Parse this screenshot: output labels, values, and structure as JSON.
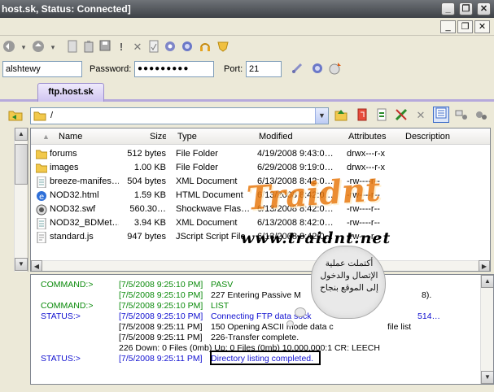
{
  "window": {
    "title": "host.sk, Status: Connected]",
    "minimize": "_",
    "close": "✕",
    "restore": "❐",
    "menu_minimize": "_",
    "menu_close": "✕"
  },
  "login": {
    "username_value": "alshtewy",
    "password_label": "Password:",
    "password_value": "●●●●●●●●●",
    "port_label": "Port:",
    "port_value": "21"
  },
  "tab": {
    "label": "ftp.host.sk"
  },
  "path": {
    "value": "/"
  },
  "files": {
    "columns": [
      "Name",
      "Size",
      "Type",
      "Modified",
      "Attributes",
      "Description"
    ],
    "rows": [
      {
        "icon": "folder-icon",
        "name": "forums",
        "size": "512 bytes",
        "type": "File Folder",
        "modified": "4/19/2008 9:43:0…",
        "attributes": "drwx---r-x"
      },
      {
        "icon": "folder-icon",
        "name": "images",
        "size": "1.00 KB",
        "type": "File Folder",
        "modified": "6/29/2008 9:19:0…",
        "attributes": "drwx---r-x"
      },
      {
        "icon": "xml-file-icon",
        "name": "breeze-manifes…",
        "size": "504 bytes",
        "type": "XML Document",
        "modified": "6/13/2008 8:42:0…",
        "attributes": "-rw----r--"
      },
      {
        "icon": "html-file-icon",
        "name": "NOD32.html",
        "size": "1.59 KB",
        "type": "HTML Document",
        "modified": "6/13/2008 8:42:0…",
        "attributes": "-rw----r--"
      },
      {
        "icon": "swf-file-icon",
        "name": "NOD32.swf",
        "size": "560.30…",
        "type": "Shockwave Flas…",
        "modified": "6/13/2008 8:42:0…",
        "attributes": "-rw----r--"
      },
      {
        "icon": "xml-file-icon",
        "name": "NOD32_BDMet…",
        "size": "3.94 KB",
        "type": "XML Document",
        "modified": "6/13/2008 8:42:0…",
        "attributes": "-rw----r--"
      },
      {
        "icon": "js-file-icon",
        "name": "standard.js",
        "size": "947 bytes",
        "type": "JScript Script File",
        "modified": "6/13/2008 8:42:0…",
        "attributes": "-rw----r--"
      }
    ]
  },
  "log": {
    "lines": [
      {
        "cmd": "COMMAND:>",
        "ts": "[7/5/2008 9:25:10 PM]",
        "msg": "PASV",
        "cmd_color": "green",
        "msg_color": "green"
      },
      {
        "cmd": "",
        "ts": "[7/5/2008 9:25:10 PM]",
        "msg": "227 Entering Passive M",
        "tail": "8).",
        "cmd_color": "green",
        "msg_color": "black"
      },
      {
        "cmd": "COMMAND:>",
        "ts": "[7/5/2008 9:25:10 PM]",
        "msg": "LIST",
        "cmd_color": "green",
        "msg_color": "green"
      },
      {
        "cmd": "STATUS:>",
        "ts": "[7/5/2008 9:25:10 PM]",
        "msg": "Connecting FTP data sock",
        "tail": "514…",
        "cmd_color": "blue",
        "msg_color": "blue"
      },
      {
        "cmd": "",
        "ts": "[7/5/2008 9:25:11 PM]",
        "msg": "150 Opening ASCII mode data c",
        "tail": "file list",
        "cmd_color": "black",
        "msg_color": "black"
      },
      {
        "cmd": "",
        "ts": "[7/5/2008 9:25:11 PM]",
        "msg": "226-Transfer complete.",
        "tail": "",
        "cmd_color": "black",
        "msg_color": "black"
      },
      {
        "cmd": "",
        "ts": "226 Down: 0 Files (0mb)  Up: 0 Files (0mb)  10,000,000:1  CR: LEECH",
        "msg": "",
        "tail": "",
        "cmd_color": "black",
        "msg_color": "black"
      },
      {
        "cmd": "STATUS:>",
        "ts": "[7/5/2008 9:25:11 PM]",
        "msg": "Directory listing completed.",
        "tail": "",
        "cmd_color": "blue",
        "msg_color": "blue"
      }
    ]
  },
  "watermark": {
    "logo": "Traidnt",
    "url": "www.traidnt.net"
  },
  "annotation": {
    "text": "أكتملت عملية الإتصال والدخول إلى الموقع بنجاح"
  },
  "colors": {
    "status_blue": "#1010d0",
    "command_green": "#0a8a0a",
    "tab_accent": "#b6a9dc",
    "watermark_orange": "#e87a10"
  }
}
